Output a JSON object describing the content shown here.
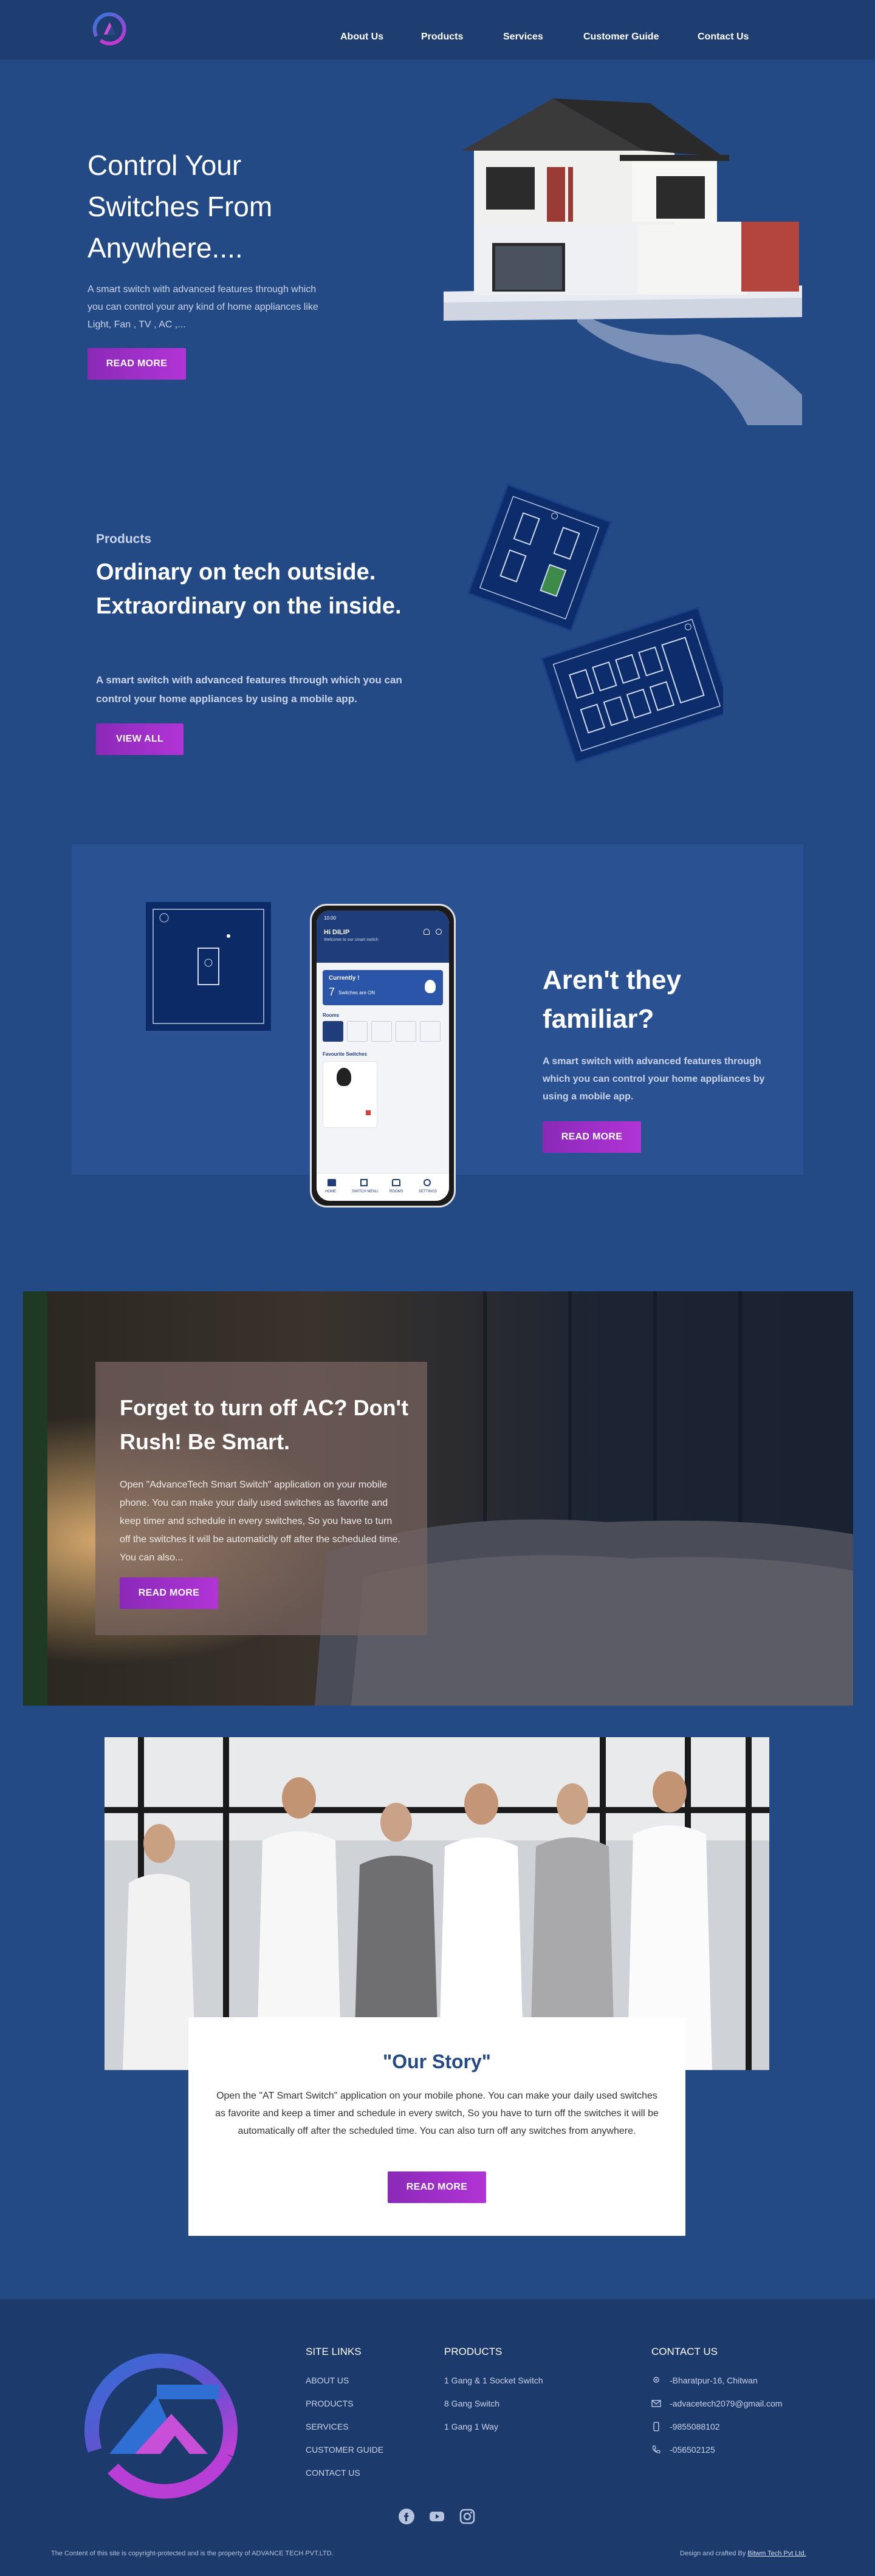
{
  "nav": {
    "items": [
      "About Us",
      "Products",
      "Services",
      "Customer Guide",
      "Contact Us"
    ]
  },
  "hero": {
    "title": "Control Your Switches From Anywhere....",
    "text": "A smart switch with advanced features through which you can control your any kind of home appliances like Light, Fan , TV , AC ,...",
    "button": "READ MORE"
  },
  "products": {
    "label": "Products",
    "title": "Ordinary on tech outside. Extraordinary on the inside.",
    "text": "A smart switch with advanced features through which you can control your home appliances by using a mobile app.",
    "button": "VIEW ALL"
  },
  "familiar": {
    "title": "Aren't they familiar?",
    "text": "A smart switch with advanced features through which you can control your home appliances by using a mobile app.",
    "button": "READ MORE",
    "phone": {
      "time": "10:00",
      "greeting": "Hi DILIP",
      "welcome": "Welcome to our smart switch",
      "currently": "Currently !",
      "count": "7",
      "switches_on": "Switches are ON",
      "rooms_label": "Rooms",
      "favourite_label": "Favourite Switches",
      "tabs": [
        "HOME",
        "SWITCH MENU",
        "ROOMS",
        "SETTINGS"
      ]
    }
  },
  "ac": {
    "title": "Forget to turn off AC? Don't Rush! Be Smart.",
    "text": "Open \"AdvanceTech Smart Switch\" application on your mobile phone. You can make your daily used switches as favorite and keep timer and schedule in every switches, So you have to turn off the switches it will be automaticlly off after the scheduled time. You can also...",
    "button": "READ MORE"
  },
  "story": {
    "title": "\"Our Story\"",
    "text": "Open the \"AT Smart Switch\" application on your mobile phone. You can make your daily used switches as favorite and keep a timer and schedule in every switch, So you have to turn off the switches it will be automatically off after the scheduled time. You can also turn off any switches from anywhere.",
    "button": "READ MORE"
  },
  "footer": {
    "site_links_heading": "SITE LINKS",
    "site_links": [
      "ABOUT US",
      "PRODUCTS",
      "SERVICES",
      "CUSTOMER GUIDE",
      "CONTACT US"
    ],
    "products_heading": "PRODUCTS",
    "products": [
      "1 Gang & 1 Socket Switch",
      "8 Gang Switch",
      "1 Gang 1 Way"
    ],
    "contact_heading": "CONTACT US",
    "contact": [
      "-Bharatpur-16, Chitwan",
      "-advacetech2079@gmail.com",
      "-9855088102",
      "-056502125"
    ],
    "copyright": "The Content of this site is copyright-protected and is the property of ADVANCE TECH PVT.LTD.",
    "crafted_prefix": "Design and crafted By",
    "crafted_by": "Bitwm Tech Pvt Ltd."
  },
  "colors": {
    "page_bg": "#244a86",
    "nav_bg": "#1e3d70",
    "button": "#b234d6",
    "footer_bg": "#1c3a6b"
  }
}
